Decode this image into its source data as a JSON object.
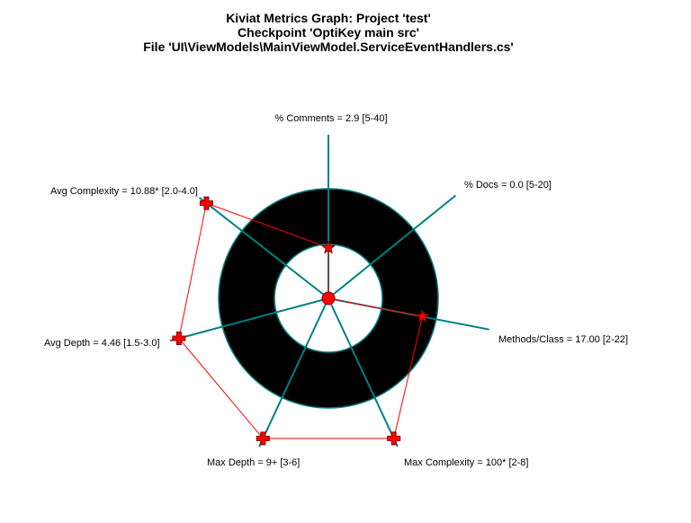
{
  "chart_data": {
    "type": "radar",
    "title": [
      "Kiviat Metrics Graph: Project 'test'",
      "Checkpoint 'OptiKey main src'",
      "File 'UI\\ViewModels\\MainViewModel.ServiceEventHandlers.cs'"
    ],
    "axes": [
      {
        "label": "% Comments = 2.9 [5-40]",
        "value": 2.9,
        "range": [
          5,
          40
        ]
      },
      {
        "label": "% Docs = 0.0 [5-20]",
        "value": 0.0,
        "range": [
          5,
          20
        ]
      },
      {
        "label": "Methods/Class = 17.00 [2-22]",
        "value": 17.0,
        "range": [
          2,
          22
        ]
      },
      {
        "label": "Max Complexity = 100* [2-8]",
        "value": 100,
        "range": [
          2,
          8
        ],
        "out_of_range": true
      },
      {
        "label": "Max Depth = 9+ [3-6]",
        "value": 9,
        "range": [
          3,
          6
        ],
        "out_of_range": true
      },
      {
        "label": "Avg Depth = 4.46 [1.5-3.0]",
        "value": 4.46,
        "range": [
          1.5,
          3.0
        ],
        "out_of_range": true
      },
      {
        "label": "Avg Complexity = 10.88* [2.0-4.0]",
        "value": 10.88,
        "range": [
          2.0,
          4.0
        ],
        "out_of_range": true
      }
    ],
    "normal_band_color": "#aaff88",
    "polygon_color": "#ff0000",
    "axis_color": "#008080",
    "marker_in_range": "star",
    "marker_out_of_range": "cross"
  }
}
